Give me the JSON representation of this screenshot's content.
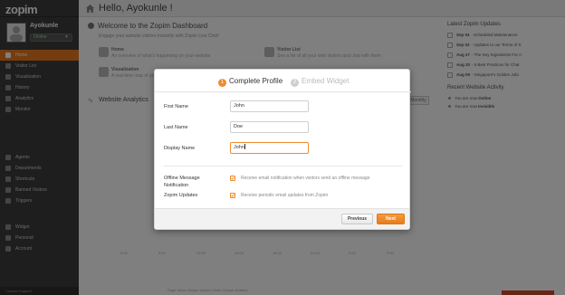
{
  "app": {
    "logo": "zopim"
  },
  "sidebar": {
    "user_name": "Ayokunle",
    "status": "Online",
    "items_top": [
      {
        "label": "Home",
        "icon": "home-icon",
        "active": true
      },
      {
        "label": "Visitor List",
        "icon": "list-icon",
        "active": false
      },
      {
        "label": "Visualization",
        "icon": "eye-icon",
        "active": false
      },
      {
        "label": "History",
        "icon": "history-icon",
        "active": false
      },
      {
        "label": "Analytics",
        "icon": "chart-icon",
        "active": false
      },
      {
        "label": "Monitor",
        "icon": "monitor-icon",
        "active": false
      }
    ],
    "items_mid": [
      {
        "label": "Agents",
        "icon": "agents-icon"
      },
      {
        "label": "Departments",
        "icon": "departments-icon"
      },
      {
        "label": "Shortcuts",
        "icon": "shortcuts-icon"
      },
      {
        "label": "Banned Visitors",
        "icon": "banned-icon"
      },
      {
        "label": "Triggers",
        "icon": "triggers-icon"
      }
    ],
    "items_bottom": [
      {
        "label": "Widget",
        "icon": "widget-icon"
      },
      {
        "label": "Personal",
        "icon": "personal-icon"
      },
      {
        "label": "Account",
        "icon": "account-icon"
      }
    ],
    "footer": "Contact Support"
  },
  "header": {
    "greeting": "Hello, Ayokunle !"
  },
  "dashboard": {
    "welcome_title": "Welcome to the Zopim Dashboard",
    "welcome_sub": "Engage your website visitors instantly with Zopim Live Chat!",
    "features": [
      {
        "title": "Home",
        "desc": "An overview of what's happening on your website"
      },
      {
        "title": "Visitor List",
        "desc": "See a list of all your web visitors and chat with them"
      },
      {
        "title": "Visualization",
        "desc": "A real-time map of your visitors"
      }
    ],
    "analytics_title": "Website Analytics",
    "monthly_tab": "Monthly",
    "chart_ticks": [
      "6:00",
      "9:00",
      "12:00",
      "15:00",
      "18:00",
      "21:00",
      "0:00",
      "3:00"
    ],
    "legend": "Page views    Unique visitors    Chats    Unique chatters"
  },
  "right": {
    "updates_title": "Latest Zopim Updates",
    "updates": [
      {
        "date": "Sep 04",
        "text": "- Scheduled Maintenance"
      },
      {
        "date": "Sep 03",
        "text": "- Updates to our Terms of S"
      },
      {
        "date": "Aug 27",
        "text": "- The Key Ingredients For A"
      },
      {
        "date": "Aug 20",
        "text": "- 5 Best Practices for Chat"
      },
      {
        "date": "Aug 09",
        "text": "- Singapore's Golden Jubi"
      }
    ],
    "activity_title": "Recent Website Activity",
    "activity": [
      {
        "prefix": "You are now",
        "value": "Online"
      },
      {
        "prefix": "You are now",
        "value": "Invisible"
      }
    ]
  },
  "modal": {
    "step1_num": "1",
    "step1_label": "Complete Profile",
    "step2_num": "2",
    "step2_label": "Embed Widget",
    "first_name_label": "First Name",
    "first_name_value": "John",
    "last_name_label": "Last Name",
    "last_name_value": "Doe",
    "display_name_label": "Display Name",
    "display_name_value": "John",
    "offline_label_1": "Offline Message",
    "offline_label_2": "Notification",
    "offline_text": "Receive email notification when visitors send an offline message",
    "updates_label": "Zopim Updates",
    "updates_text": "Receive periodic email updates from Zopim",
    "prev_button": "Previous",
    "next_button": "Next"
  },
  "colors": {
    "accent": "#ef8b2c",
    "sidebar": "#3d3d3d",
    "active": "#ea7a1e"
  }
}
